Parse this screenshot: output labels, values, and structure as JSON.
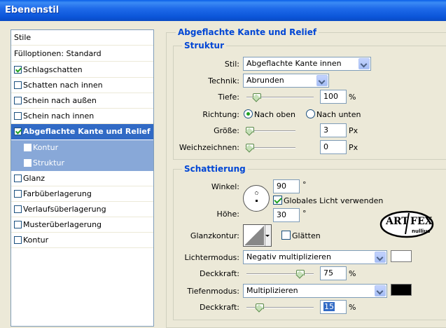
{
  "window": {
    "title": "Ebenenstil"
  },
  "sidebar": {
    "header": "Stile",
    "items": [
      {
        "label": "Fülloptionen: Standard",
        "checkbox": false
      },
      {
        "label": "Schlagschatten",
        "checked": true
      },
      {
        "label": "Schatten nach innen",
        "checked": false
      },
      {
        "label": "Schein nach außen",
        "checked": false
      },
      {
        "label": "Schein nach innen",
        "checked": false
      },
      {
        "label": "Abgeflachte Kante und Relief",
        "checked": true,
        "selected": true
      },
      {
        "label": "Kontur",
        "checked": false,
        "sub": true
      },
      {
        "label": "Struktur",
        "checked": false,
        "sub": true
      },
      {
        "label": "Glanz",
        "checked": false
      },
      {
        "label": "Farbüberlagerung",
        "checked": false
      },
      {
        "label": "Verlaufsüberlagerung",
        "checked": false
      },
      {
        "label": "Musterüberlagerung",
        "checked": false
      },
      {
        "label": "Kontur",
        "checked": false
      }
    ]
  },
  "bevel": {
    "title": "Abgeflachte Kante und Relief",
    "structure": {
      "title": "Struktur",
      "style_label": "Stil:",
      "style_value": "Abgeflachte Kante innen",
      "technique_label": "Technik:",
      "technique_value": "Abrunden",
      "depth_label": "Tiefe:",
      "depth_value": "100",
      "depth_unit": "%",
      "depth_level": 0.1,
      "direction_label": "Richtung:",
      "direction_up": "Nach oben",
      "direction_down": "Nach unten",
      "size_label": "Größe:",
      "size_value": "3",
      "size_unit": "Px",
      "size_level": 0.0,
      "soften_label": "Weichzeichnen:",
      "soften_value": "0",
      "soften_unit": "Px",
      "soften_level": 0.0
    },
    "shading": {
      "title": "Schattierung",
      "angle_label": "Winkel:",
      "angle_value": "90",
      "angle_unit": "°",
      "global_light_label": "Globales Licht verwenden",
      "altitude_label": "Höhe:",
      "altitude_value": "30",
      "altitude_unit": "°",
      "gloss_label": "Glanzkontur:",
      "smooth_label": "Glätten",
      "highlight_label": "Lichtermodus:",
      "highlight_value": "Negativ multiplizieren",
      "highlight_color": "#ffffff",
      "highlight_opacity_label": "Deckkraft:",
      "highlight_opacity_value": "75",
      "highlight_opacity_unit": "%",
      "highlight_opacity_level": 0.75,
      "shadow_label": "Tiefenmodus:",
      "shadow_value": "Multiplizieren",
      "shadow_color": "#000000",
      "shadow_opacity_label": "Deckkraft:",
      "shadow_opacity_value": "15",
      "shadow_opacity_unit": "%",
      "shadow_opacity_level": 0.15
    }
  },
  "logo": {
    "text_left": "ART",
    "text_right": "FEX",
    "text_bottom": "nullius"
  }
}
